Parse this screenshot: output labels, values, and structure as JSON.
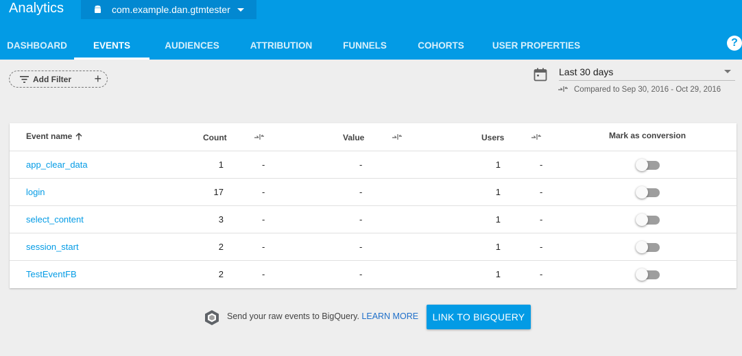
{
  "header": {
    "app_title": "Analytics",
    "app_selector": {
      "name": "com.example.dan.gtmtester",
      "icon": "android-icon"
    },
    "help_icon_glyph": "?"
  },
  "tabs": [
    {
      "label": "DASHBOARD",
      "active": false
    },
    {
      "label": "EVENTS",
      "active": true
    },
    {
      "label": "AUDIENCES",
      "active": false
    },
    {
      "label": "ATTRIBUTION",
      "active": false
    },
    {
      "label": "FUNNELS",
      "active": false
    },
    {
      "label": "COHORTS",
      "active": false
    },
    {
      "label": "USER PROPERTIES",
      "active": false
    }
  ],
  "filter": {
    "add_filter_label": "Add Filter",
    "plus_glyph": "+"
  },
  "date_range": {
    "selected": "Last 30 days",
    "compared_text": "Compared to Sep 30, 2016 - Oct 29, 2016"
  },
  "table": {
    "headers": {
      "event_name": "Event name",
      "count": "Count",
      "value": "Value",
      "users": "Users",
      "mark_as_conversion": "Mark as conversion"
    },
    "rows": [
      {
        "name": "app_clear_data",
        "count": "1",
        "count_change": "-",
        "value": "-",
        "users": "1",
        "users_change": "-",
        "conversion": false
      },
      {
        "name": "login",
        "count": "17",
        "count_change": "-",
        "value": "-",
        "users": "1",
        "users_change": "-",
        "conversion": false
      },
      {
        "name": "select_content",
        "count": "3",
        "count_change": "-",
        "value": "-",
        "users": "1",
        "users_change": "-",
        "conversion": false
      },
      {
        "name": "session_start",
        "count": "2",
        "count_change": "-",
        "value": "-",
        "users": "1",
        "users_change": "-",
        "conversion": false
      },
      {
        "name": "TestEventFB",
        "count": "2",
        "count_change": "-",
        "value": "-",
        "users": "1",
        "users_change": "-",
        "conversion": false
      }
    ]
  },
  "bigquery": {
    "text": "Send your raw events to BigQuery.",
    "learn_more": "LEARN MORE",
    "button": "LINK TO BIGQUERY"
  },
  "colors": {
    "header": "#039be5",
    "app_selector": "#0288d1",
    "link": "#039be5",
    "page_bg": "#eeeeee"
  }
}
